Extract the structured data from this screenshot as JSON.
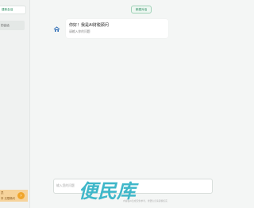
{
  "sidebar": {
    "new_chat_label": "建新会话",
    "sessions": [
      {
        "label": "的会话"
      }
    ],
    "promo": {
      "line1": "员",
      "line2": "享 无限畅问"
    }
  },
  "header": {
    "button_label": "新建对话"
  },
  "chat": {
    "greeting_title": "你好！我是AI财税顾问",
    "greeting_subtitle": "请输入你的问题"
  },
  "composer": {
    "placeholder": "输入您的问题"
  },
  "footer": {
    "disclaimer": "内容由AI生成仅供参考，重要信息请谨慎核实"
  },
  "watermark": {
    "text": "便民库"
  },
  "colors": {
    "accent": "#23885a",
    "promo_bg": "#f6d39b",
    "watermark": "#3fb7c9"
  }
}
